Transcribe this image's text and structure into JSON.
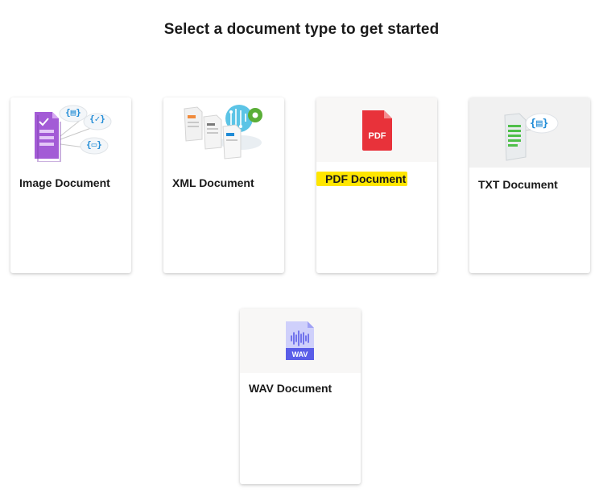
{
  "heading": "Select a document type to get started",
  "cards": [
    {
      "title": "Image Document",
      "icon": "image-document-icon"
    },
    {
      "title": "XML Document",
      "icon": "xml-document-icon"
    },
    {
      "title": "PDF Document",
      "icon": "pdf-document-icon",
      "highlighted": true,
      "icon_label": "PDF"
    },
    {
      "title": "TXT Document",
      "icon": "txt-document-icon"
    },
    {
      "title": "WAV Document",
      "icon": "wav-document-icon",
      "icon_label": "WAV"
    }
  ],
  "colors": {
    "highlight": "#ffe600",
    "pdf_red": "#e8323a",
    "wav_purple": "#5a5de8",
    "accent_blue": "#1f8bd6"
  }
}
